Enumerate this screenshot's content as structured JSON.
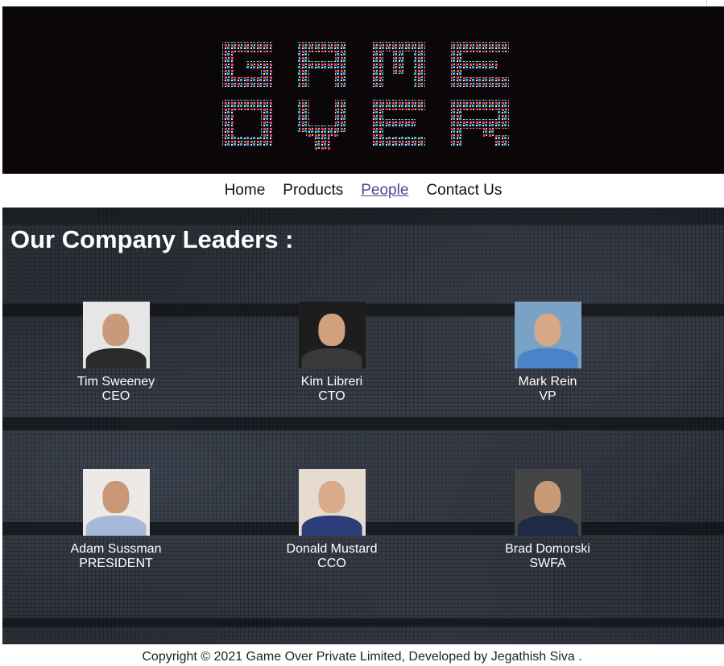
{
  "banner": {
    "logo_alt": "GAME OVER",
    "logo_lines": [
      "GAME",
      "OVER"
    ],
    "colors": {
      "background": "#0b0608",
      "pink": "#e23c93",
      "cyan": "#36b2d8",
      "yellow": "#f1c232"
    }
  },
  "nav": {
    "items": [
      {
        "label": "Home",
        "active": false
      },
      {
        "label": "Products",
        "active": false
      },
      {
        "label": "People",
        "active": true
      },
      {
        "label": "Contact Us",
        "active": false
      }
    ]
  },
  "main": {
    "title": "Our Company Leaders :",
    "leaders": [
      {
        "name": "Tim Sweeney",
        "role": "CEO",
        "photo_bg": "#e6e6e6",
        "skin": "#c9997c",
        "shirt": "#2a2a2a"
      },
      {
        "name": "Kim Libreri",
        "role": "CTO",
        "photo_bg": "#1d1d1d",
        "skin": "#d1a07d",
        "shirt": "#3a3a3a"
      },
      {
        "name": "Mark Rein",
        "role": "VP",
        "photo_bg": "#7aa2c6",
        "skin": "#d7a888",
        "shirt": "#4a83c7"
      },
      {
        "name": "Adam Sussman",
        "role": "PRESIDENT",
        "photo_bg": "#ece9e6",
        "skin": "#c89777",
        "shirt": "#a7b9d8"
      },
      {
        "name": "Donald Mustard",
        "role": "CCO",
        "photo_bg": "#e5dccf",
        "skin": "#d9ab8a",
        "shirt": "#2c3e7a"
      },
      {
        "name": "Brad Domorski",
        "role": "SWFA",
        "photo_bg": "#454545",
        "skin": "#c99a78",
        "shirt": "#1f2a44"
      }
    ]
  },
  "footer": {
    "text": "Copyright © 2021 Game Over Private Limited, Developed by Jegathish Siva ."
  }
}
